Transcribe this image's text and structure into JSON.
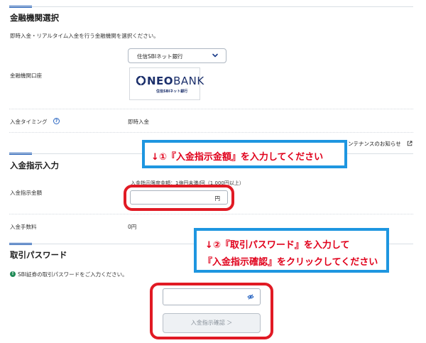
{
  "sections": {
    "bank_select": {
      "title": "金融機関選択",
      "description": "即時入金・リアルタイム入金を行う金融機関を選択ください。",
      "account_label": "金融機関口座",
      "selected_bank": "住信SBIネット銀行",
      "logo_text_neo": "NEO",
      "logo_text_bank": "BANK",
      "logo_subtext": "住信SBIネット銀行",
      "timing_label": "入金タイミング",
      "timing_value": "即時入金",
      "maintenance_link": "ンテナンスのお知らせ"
    },
    "deposit_input": {
      "title": "入金指示入力",
      "amount_label": "入金指示金額",
      "limit_note": "入金指示限度金額：1億円未満/回（1,000円以上）",
      "amount_unit": "円",
      "fee_label": "入金手数料",
      "fee_value": "0円"
    },
    "password": {
      "title": "取引パスワード",
      "instruction": "SBI証券の取引パスワードをご入力ください。",
      "confirm_button": "入金指示確認 ＞"
    }
  },
  "callouts": {
    "first": "↓①『入金指示金額』を入力してください",
    "second_line1": "↓②『取引パスワード』を入力して",
    "second_line2": "『入金指示確認』をクリックしてください"
  },
  "colors": {
    "accent": "#1a5ab8",
    "callout_border": "#1e96e0",
    "callout_text": "#e0001b",
    "highlight_ring": "#e11a24"
  },
  "icons": {
    "help": "question-circle-icon",
    "dropdown": "chevron-down-icon",
    "external": "external-link-icon",
    "info": "info-circle-icon",
    "eye": "eye-slash-icon"
  }
}
